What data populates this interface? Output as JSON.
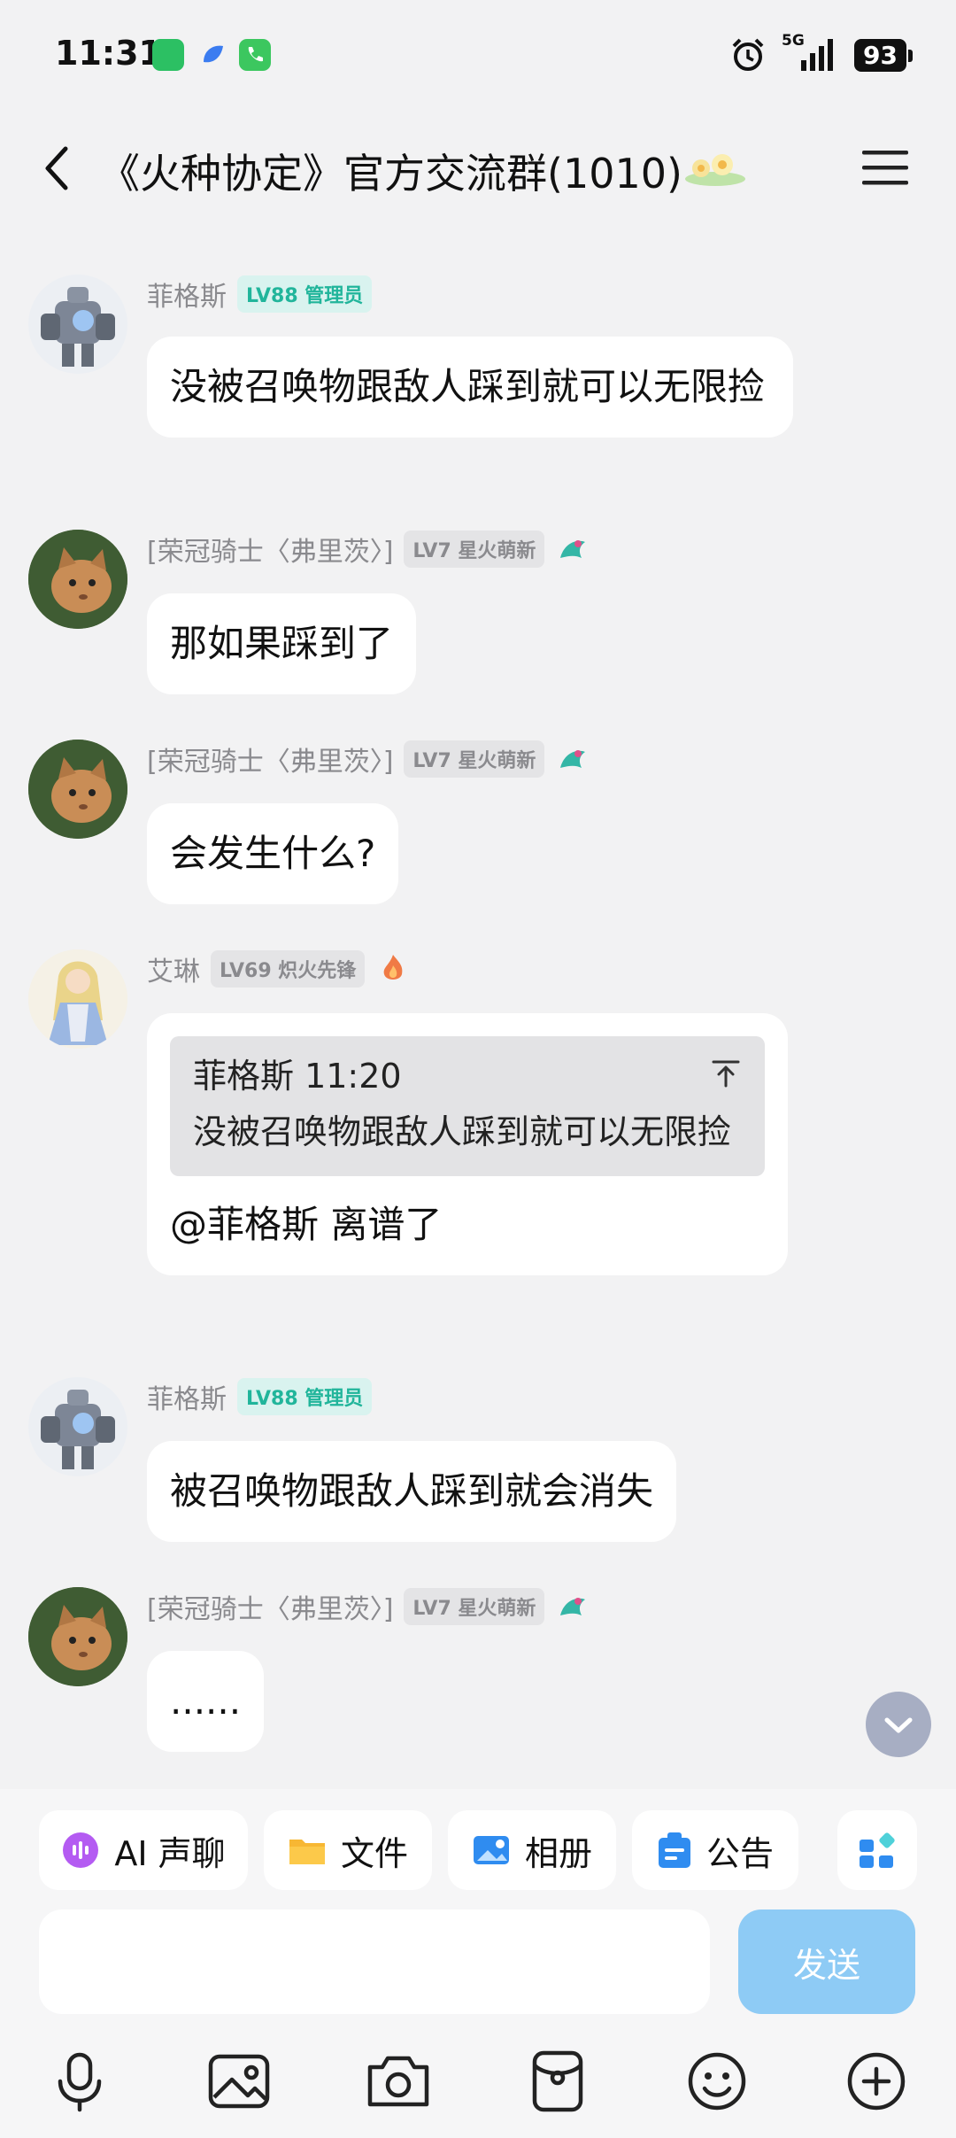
{
  "status_bar": {
    "time": "11:31",
    "network": "5G",
    "battery": "93"
  },
  "header": {
    "title": "《火种协定》官方交流群(1010)"
  },
  "messages": [
    {
      "sender": "菲格斯",
      "badge": "LV88 管理员",
      "text": "没被召唤物跟敌人踩到就可以无限捡"
    },
    {
      "sender": "[荣冠骑士〈弗里茨〉]",
      "badge": "LV7 星火萌新",
      "text": "那如果踩到了"
    },
    {
      "sender": "[荣冠骑士〈弗里茨〉]",
      "badge": "LV7 星火萌新",
      "text": "会发生什么?"
    },
    {
      "sender": "艾琳",
      "badge": "LV69 炽火先锋",
      "quote": {
        "head": "菲格斯 11:20",
        "text": "没被召唤物跟敌人踩到就可以无限捡"
      },
      "text": "@菲格斯 离谱了"
    },
    {
      "sender": "菲格斯",
      "badge": "LV88 管理员",
      "text": "被召唤物跟敌人踩到就会消失"
    },
    {
      "sender": "[荣冠骑士〈弗里茨〉]",
      "badge": "LV7 星火萌新",
      "text": "......"
    }
  ],
  "toolbar": {
    "ai_voice": "AI 声聊",
    "file": "文件",
    "album": "相册",
    "notice": "公告"
  },
  "input": {
    "send_label": "发送"
  },
  "icons": {
    "bottom": [
      "microphone-icon",
      "image-icon",
      "camera-icon",
      "red-packet-icon",
      "emoji-icon",
      "plus-icon"
    ]
  },
  "colors": {
    "accent_teal": "#21b59b",
    "send_button": "#8ecbf5",
    "bubble": "#ffffff",
    "background": "#f2f2f3"
  }
}
